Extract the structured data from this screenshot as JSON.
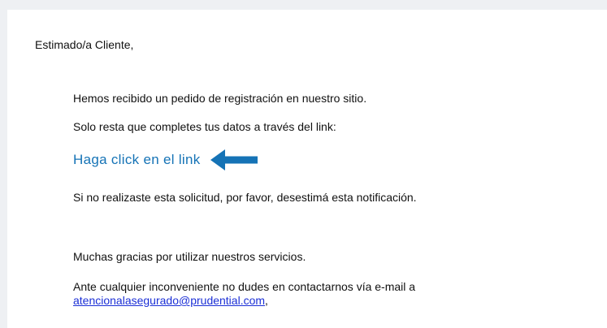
{
  "email": {
    "greeting": "Estimado/a Cliente,",
    "line_received": "Hemos recibido un pedido de registración en nuestro sitio.",
    "line_complete": "Solo resta que completes tus datos a través del link:",
    "cta_link_text": "Haga click en el link",
    "arrow_icon": "arrow-left-icon",
    "line_ignore": "Si no realizaste esta solicitud, por favor, desestimá esta notificación.",
    "line_thanks": "Muchas gracias por utilizar nuestros servicios.",
    "line_contact": "Ante cualquier inconveniente no dudes en contactarnos vía e-mail a",
    "contact_email": "atencionalasegurado@prudential.com",
    "contact_suffix": ","
  },
  "colors": {
    "background": "#eef0f3",
    "card": "#ffffff",
    "cta_link": "#1573b6",
    "arrow": "#1573b6",
    "email_link": "#1b2fd6"
  }
}
